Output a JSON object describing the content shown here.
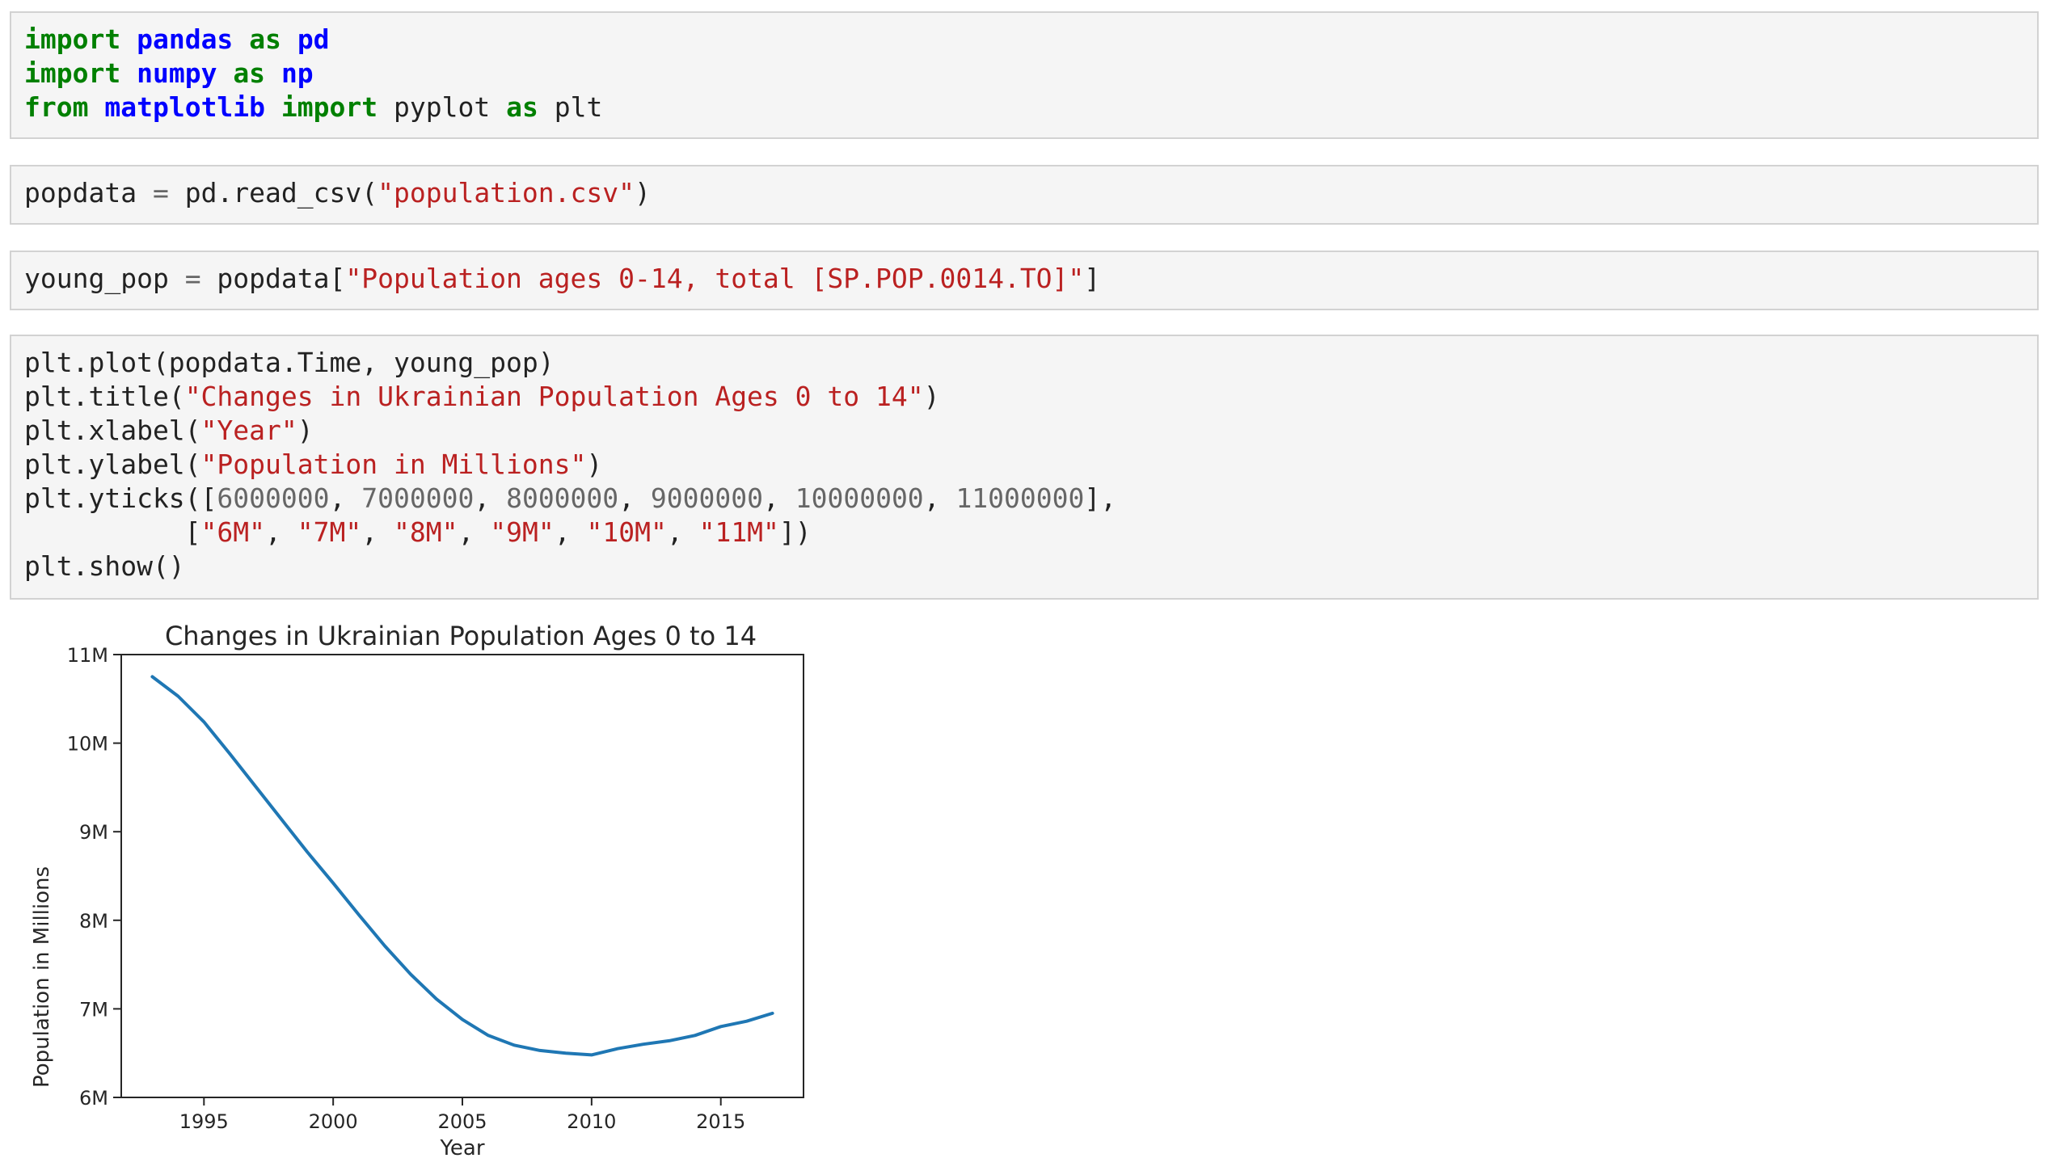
{
  "cells": {
    "imports": {
      "line1": {
        "kw1": "import",
        "mod": "pandas",
        "kw2": "as",
        "alias": "pd"
      },
      "line2": {
        "kw1": "import",
        "mod": "numpy",
        "kw2": "as",
        "alias": "np"
      },
      "line3": {
        "kw1": "from",
        "mod": "matplotlib",
        "kw2": "import",
        "name": "pyplot",
        "kw3": "as",
        "alias": "plt"
      }
    },
    "read_csv": {
      "pre": "popdata ",
      "op": "=",
      "mid": " pd.read_csv(",
      "str": "\"population.csv\"",
      "post": ")"
    },
    "young_pop": {
      "pre": "young_pop ",
      "op": "=",
      "mid": " popdata[",
      "str": "\"Population ages 0-14, total [SP.POP.0014.TO]\"",
      "post": "]"
    },
    "plot_cell": {
      "l1": "plt.plot(popdata.Time, young_pop)",
      "l2_pre": "plt.title(",
      "l2_str": "\"Changes in Ukrainian Population Ages 0 to 14\"",
      "l2_post": ")",
      "l3_pre": "plt.xlabel(",
      "l3_str": "\"Year\"",
      "l3_post": ")",
      "l4_pre": "plt.ylabel(",
      "l4_str": "\"Population in Millions\"",
      "l4_post": ")",
      "l5_pre": "plt.yticks([",
      "l5_nums": [
        "6000000",
        "7000000",
        "8000000",
        "9000000",
        "10000000",
        "11000000"
      ],
      "l5_post": "],",
      "l6_indent": "          [",
      "l6_strs": [
        "\"6M\"",
        "\"7M\"",
        "\"8M\"",
        "\"9M\"",
        "\"10M\"",
        "\"11M\""
      ],
      "l6_post": "])",
      "l7": "plt.show()"
    }
  },
  "chart_data": {
    "type": "line",
    "title": "Changes in Ukrainian Population Ages 0 to 14",
    "xlabel": "Year",
    "ylabel": "Population in Millions",
    "xlim": [
      1991.8,
      2018.2
    ],
    "ylim": [
      6000000,
      11000000
    ],
    "xticks": [
      1995,
      2000,
      2005,
      2010,
      2015
    ],
    "xtick_labels": [
      "1995",
      "2000",
      "2005",
      "2010",
      "2015"
    ],
    "yticks": [
      6000000,
      7000000,
      8000000,
      9000000,
      10000000,
      11000000
    ],
    "ytick_labels": [
      "6M",
      "7M",
      "8M",
      "9M",
      "10M",
      "11M"
    ],
    "grid": false,
    "line_color": "#1f77b4",
    "x": [
      1993,
      1994,
      1995,
      1996,
      1997,
      1998,
      1999,
      2000,
      2001,
      2002,
      2003,
      2004,
      2005,
      2006,
      2007,
      2008,
      2009,
      2010,
      2011,
      2012,
      2013,
      2014,
      2015,
      2016,
      2017
    ],
    "y": [
      10750000,
      10530000,
      10240000,
      9880000,
      9510000,
      9140000,
      8770000,
      8420000,
      8060000,
      7710000,
      7390000,
      7110000,
      6880000,
      6700000,
      6590000,
      6530000,
      6500000,
      6480000,
      6550000,
      6600000,
      6640000,
      6700000,
      6800000,
      6860000,
      6950000
    ]
  }
}
